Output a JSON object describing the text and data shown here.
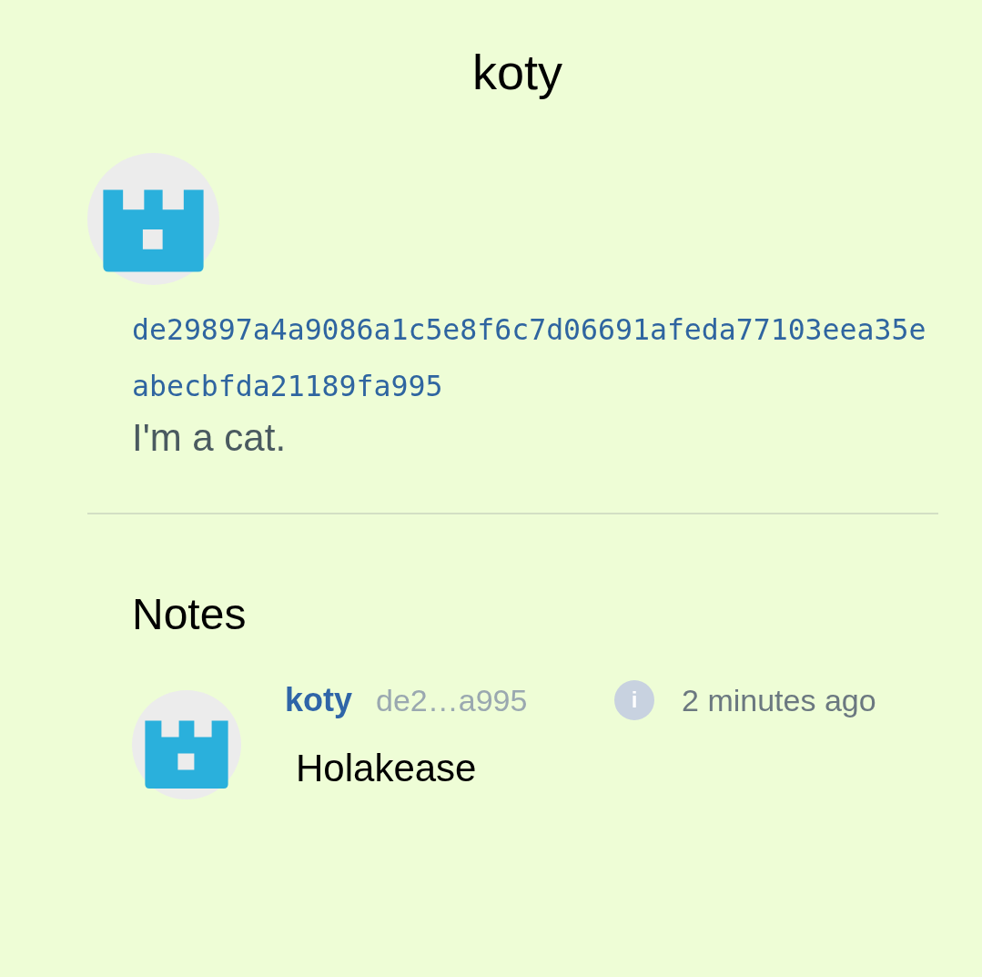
{
  "title": "koty",
  "profile": {
    "pubkey": "de29897a4a9086a1c5e8f6c7d06691afeda77103eea35eabecbfda21189fa995",
    "about": "I'm a cat."
  },
  "notes": {
    "heading": "Notes",
    "items": [
      {
        "author": "koty",
        "short_key": "de2…a995",
        "info_icon": "i",
        "time": "2 minutes ago",
        "content": "Holakease"
      }
    ]
  }
}
